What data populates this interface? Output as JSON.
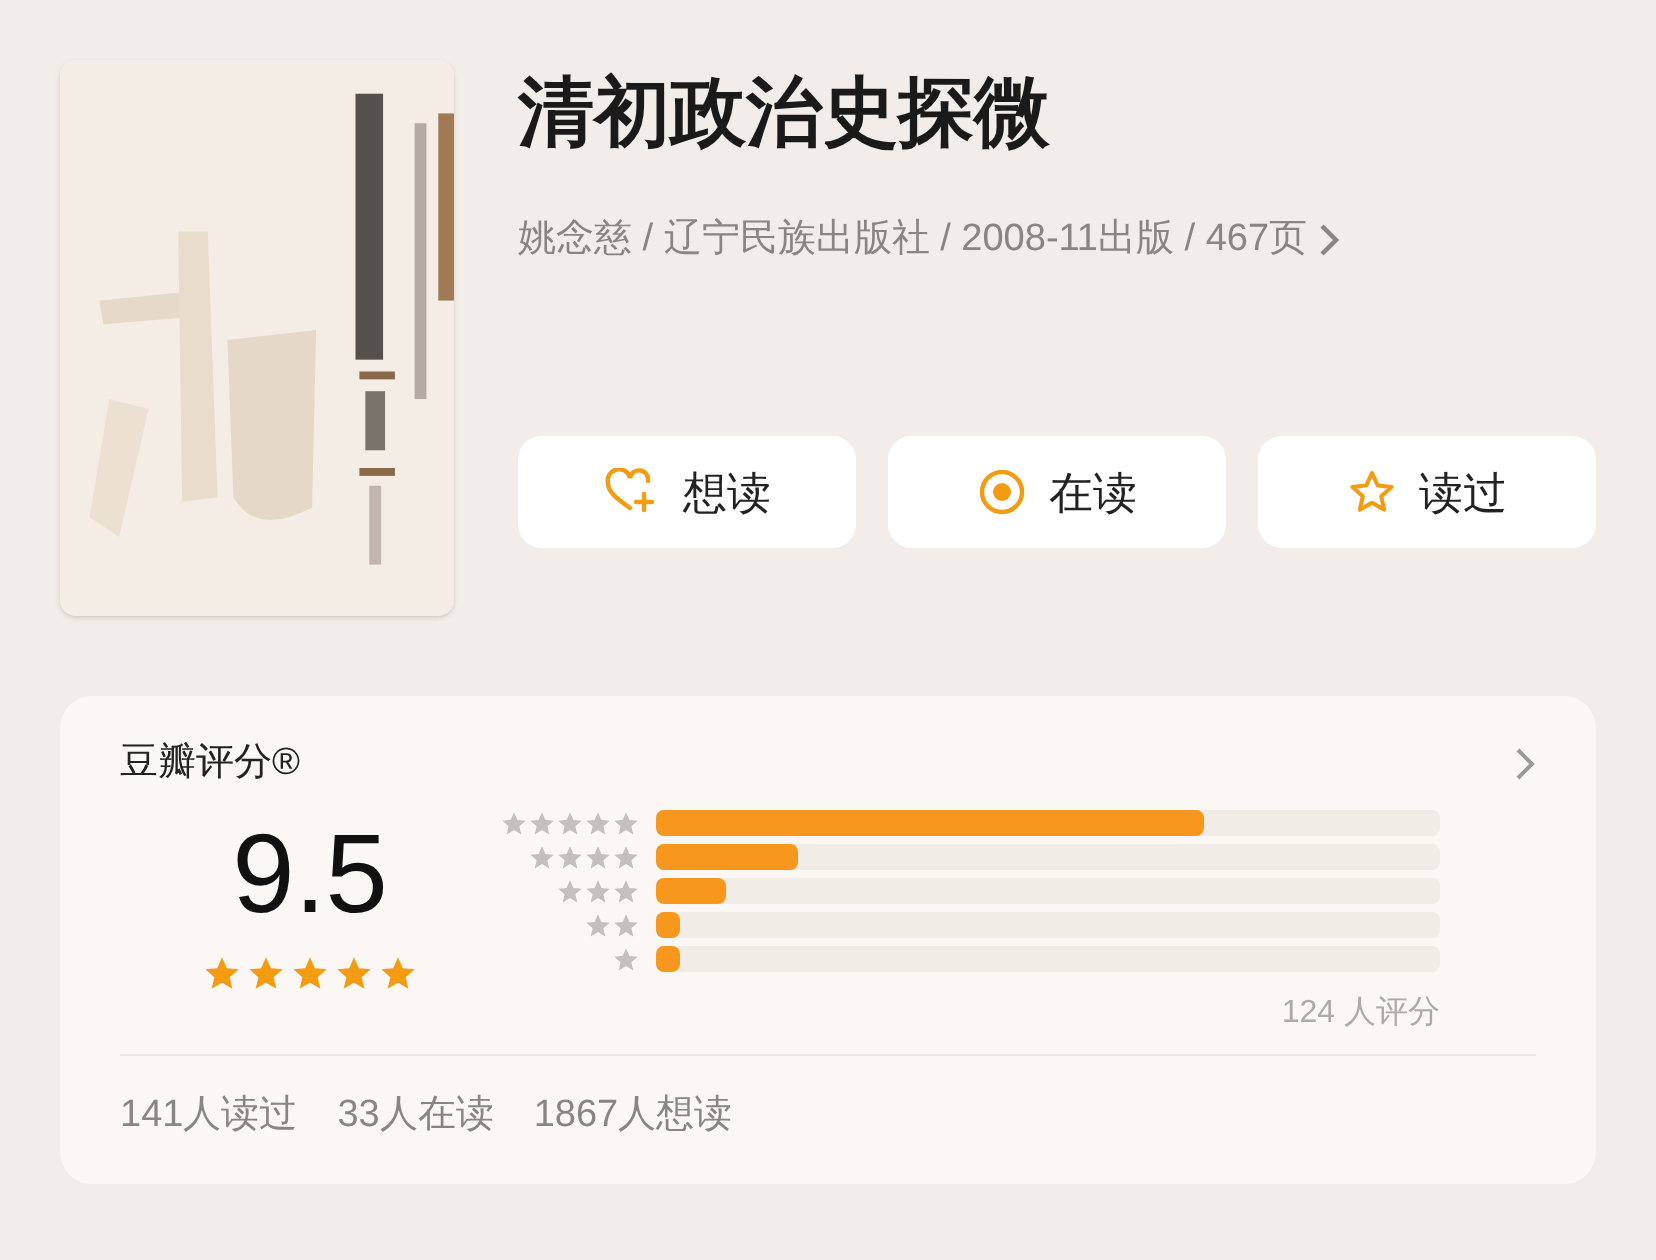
{
  "book": {
    "title": "清初政治史探微",
    "meta": "姚念慈 / 辽宁民族出版社 / 2008-11出版 / 467页"
  },
  "actions": [
    {
      "kind": "heart",
      "label": "想读"
    },
    {
      "kind": "target",
      "label": "在读"
    },
    {
      "kind": "star",
      "label": "读过"
    }
  ],
  "rating": {
    "title": "豆瓣评分®",
    "score": "9.5",
    "stars": 5,
    "bars": [
      {
        "level": 0.7
      },
      {
        "level": 0.18
      },
      {
        "level": 0.09
      },
      {
        "level": 0.03
      },
      {
        "level": 0.03
      }
    ],
    "count": "124 人评分",
    "stats": [
      "141人读过",
      "33人在读",
      "1867人想读"
    ]
  }
}
